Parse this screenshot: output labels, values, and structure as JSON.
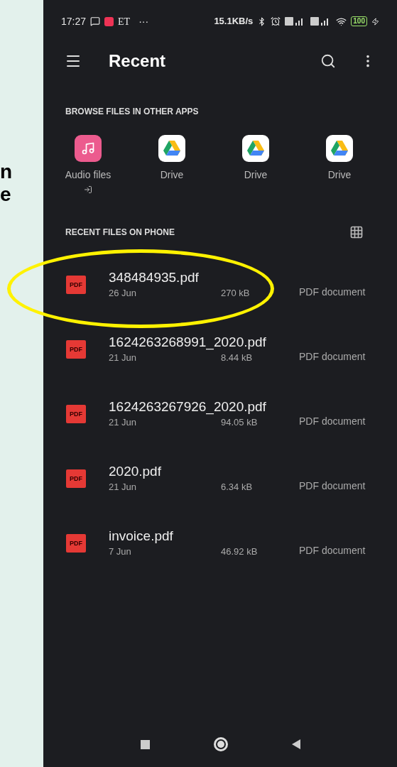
{
  "backdrop": {
    "text_fragments": [
      "n",
      "e"
    ]
  },
  "status_bar": {
    "time": "17:27",
    "carrier": "ET",
    "more": "···",
    "speed": "15.1KB/s",
    "battery": "100"
  },
  "app_bar": {
    "title": "Recent"
  },
  "browse": {
    "heading": "BROWSE FILES IN OTHER APPS",
    "apps": [
      {
        "kind": "audio",
        "label": "Audio files",
        "external": true
      },
      {
        "kind": "drive",
        "label": "Drive",
        "external": false
      },
      {
        "kind": "drive",
        "label": "Drive",
        "external": false
      },
      {
        "kind": "drive",
        "label": "Drive",
        "external": false
      }
    ]
  },
  "recent": {
    "heading": "RECENT FILES ON PHONE",
    "files": [
      {
        "icon_label": "PDF",
        "name": "348484935.pdf",
        "date": "26 Jun",
        "size": "270 kB",
        "type": "PDF document",
        "circled": true
      },
      {
        "icon_label": "PDF",
        "name": "1624263268991_2020.pdf",
        "date": "21 Jun",
        "size": "8.44 kB",
        "type": "PDF document",
        "circled": false
      },
      {
        "icon_label": "PDF",
        "name": "1624263267926_2020.pdf",
        "date": "21 Jun",
        "size": "94.05 kB",
        "type": "PDF document",
        "circled": false
      },
      {
        "icon_label": "PDF",
        "name": "2020.pdf",
        "date": "21 Jun",
        "size": "6.34 kB",
        "type": "PDF document",
        "circled": false
      },
      {
        "icon_label": "PDF",
        "name": "invoice.pdf",
        "date": "7 Jun",
        "size": "46.92 kB",
        "type": "PDF document",
        "circled": false
      }
    ]
  }
}
